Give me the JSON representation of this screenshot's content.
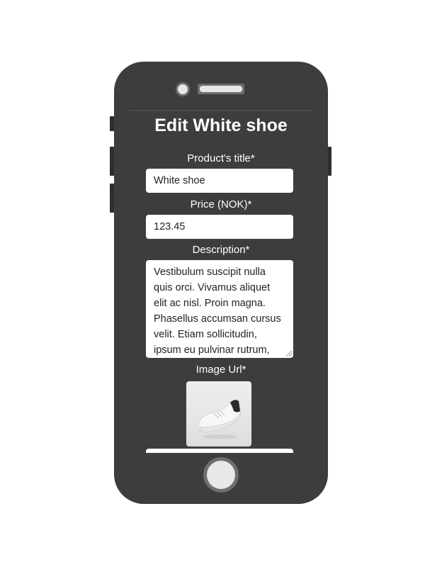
{
  "page": {
    "title": "Edit White shoe"
  },
  "form": {
    "title_label": "Product's title*",
    "title_value": "White shoe",
    "price_label": "Price (NOK)*",
    "price_value": "123.45",
    "description_label": "Description*",
    "description_value": "Vestibulum suscipit nulla quis orci. Vivamus aliquet elit ac nisl. Proin magna. Phasellus accumsan cursus velit. Etiam sollicitudin, ipsum eu pulvinar rutrum,",
    "image_label": "Image Url*",
    "image_icon": "white-sneaker-product-image"
  },
  "colors": {
    "phone_body": "#3d3d3d",
    "text": "#ffffff",
    "field_bg": "#ffffff"
  }
}
